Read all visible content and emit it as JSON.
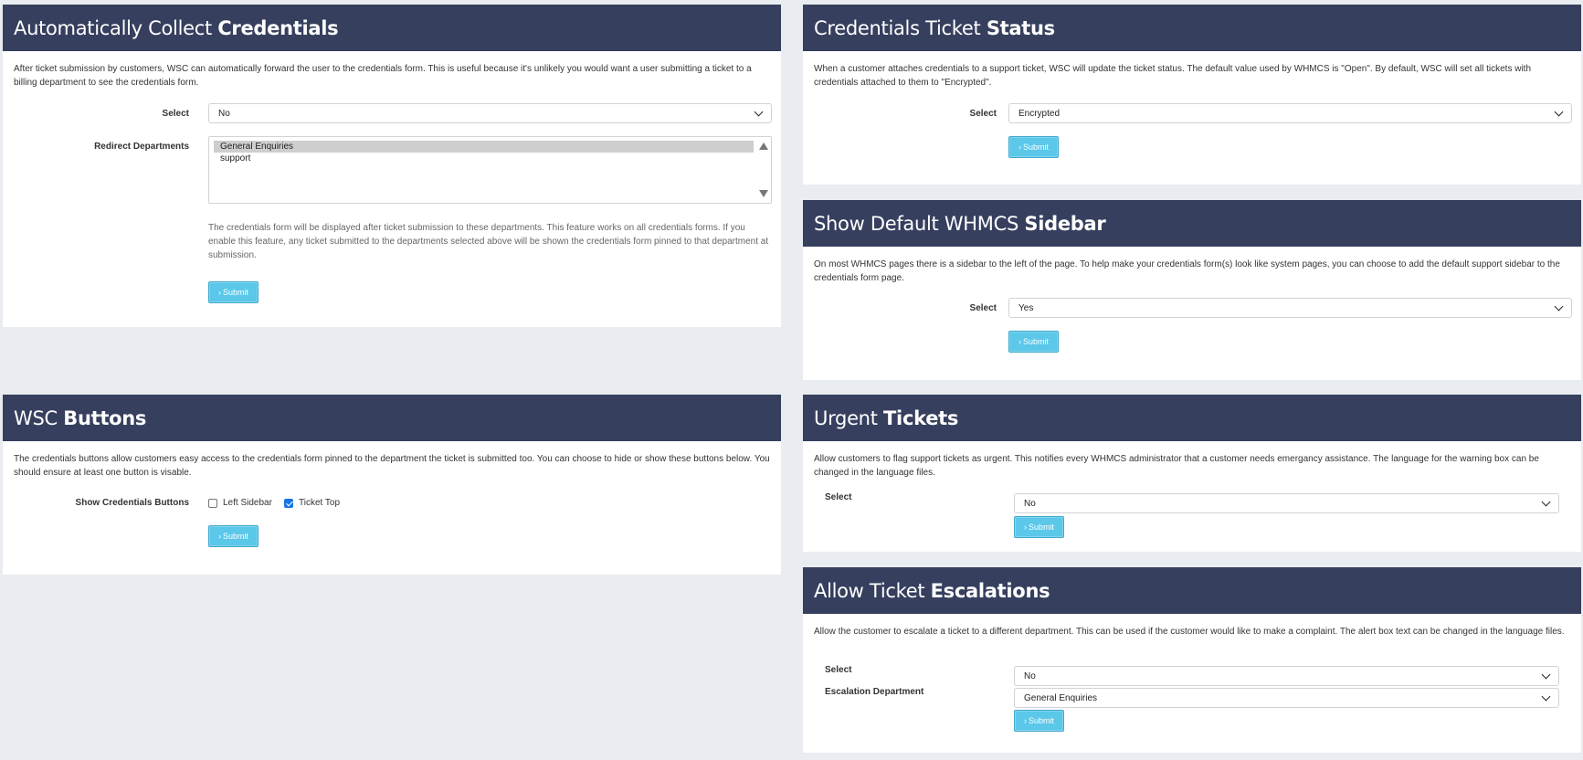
{
  "auto_collect": {
    "title_light": "Automatically Collect ",
    "title_bold": "Credentials",
    "description": "After ticket submission by customers, WSC can automatically forward the user to the credentials form. This is useful because it's unlikely you would want a user submitting a ticket to a billing department to see the credentials form.",
    "select_label": "Select",
    "select_value": "No",
    "redirect_label": "Redirect Departments",
    "departments": [
      "General Enquiries",
      "support"
    ],
    "hint": "The credentials form will be displayed after ticket submission to these departments. This feature works on all credentials forms. If you enable this feature, any ticket submitted to the departments selected above will be shown the credentials form pinned to that department at submission.",
    "submit_label": "Submit"
  },
  "wsc_buttons": {
    "title_light": "WSC ",
    "title_bold": "Buttons",
    "description": "The credentials buttons allow customers easy access to the credentials form pinned to the department the ticket is submitted too. You can choose to hide or show these buttons below. You should ensure at least one button is visable.",
    "show_label": "Show Credentials Buttons",
    "left_sidebar_label": "Left Sidebar",
    "left_sidebar_checked": false,
    "ticket_top_label": "Ticket Top",
    "ticket_top_checked": true,
    "submit_label": "Submit"
  },
  "ticket_status": {
    "title_light": "Credentials Ticket ",
    "title_bold": "Status",
    "description": "When a customer attaches credentials to a support ticket, WSC will update the ticket status. The default value used by WHMCS is \"Open\". By default, WSC will set all tickets with credentials attached to them to \"Encrypted\".",
    "select_label": "Select",
    "select_value": "Encrypted",
    "submit_label": "Submit"
  },
  "default_sidebar": {
    "title_light": "Show Default WHMCS ",
    "title_bold": "Sidebar",
    "description": "On most WHMCS pages there is a sidebar to the left of the page. To help make your credentials form(s) look like system pages, you can choose to add the default support sidebar to the credentials form page.",
    "select_label": "Select",
    "select_value": "Yes",
    "submit_label": "Submit"
  },
  "urgent_tickets": {
    "title_light": "Urgent ",
    "title_bold": "Tickets",
    "description": "Allow customers to flag support tickets as urgent. This notifies every WHMCS administrator that a customer needs emergancy assistance. The language for the warning box can be changed in the language files.",
    "select_label": "Select",
    "select_value": "No",
    "submit_label": "Submit"
  },
  "escalations": {
    "title_light": "Allow Ticket ",
    "title_bold": "Escalations",
    "description": "Allow the customer to escalate a ticket to a different department. This can be used if the customer would like to make a complaint. The alert box text can be changed in the language files.",
    "select_label": "Select",
    "select_value": "No",
    "dept_label": "Escalation Department",
    "dept_value": "General Enquiries",
    "submit_label": "Submit"
  },
  "colors": {
    "header_bg": "#363f5e",
    "page_bg": "#e9ecf0",
    "button_bg": "#5bc7e9",
    "checkbox_on": "#1a73e8"
  }
}
